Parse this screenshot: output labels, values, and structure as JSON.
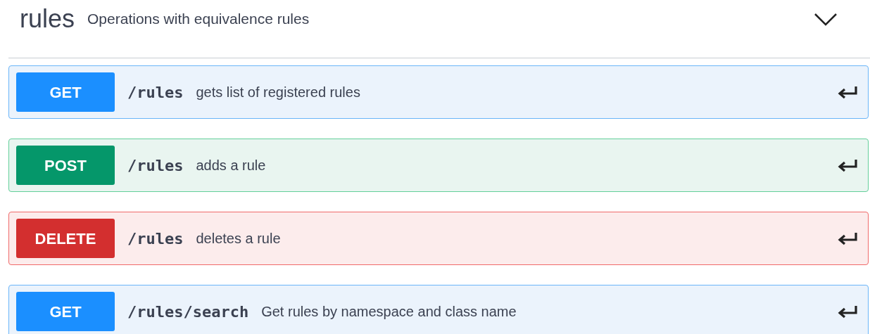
{
  "section": {
    "title": "rules",
    "description": "Operations with equivalence rules",
    "expanded": true
  },
  "operations": [
    {
      "kind": "get",
      "method": "GET",
      "color": "#1b8fff",
      "path": "/rules",
      "summary": "gets list of registered rules"
    },
    {
      "kind": "post",
      "method": "POST",
      "color": "#05976a",
      "path": "/rules",
      "summary": "adds a rule"
    },
    {
      "kind": "delete",
      "method": "DELETE",
      "color": "#d32f2f",
      "path": "/rules",
      "summary": "deletes a rule"
    },
    {
      "kind": "get",
      "method": "GET",
      "color": "#1b8fff",
      "path": "/rules/search",
      "summary": "Get rules by namespace and class name"
    }
  ]
}
